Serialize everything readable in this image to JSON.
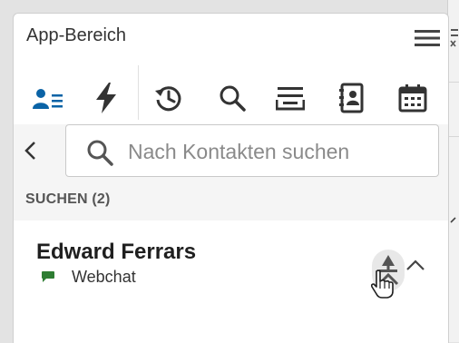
{
  "panel": {
    "title": "App-Bereich",
    "menu_icon": "hamburger-menu-icon"
  },
  "toolbar": {
    "active": "contacts",
    "items": [
      {
        "id": "contacts",
        "icon": "contacts-list-icon"
      },
      {
        "id": "actions",
        "icon": "lightning-icon"
      },
      {
        "id": "history",
        "icon": "history-icon"
      },
      {
        "id": "search",
        "icon": "search-icon"
      },
      {
        "id": "queue",
        "icon": "inbox-tray-icon"
      },
      {
        "id": "address-book",
        "icon": "address-book-icon"
      },
      {
        "id": "calendar",
        "icon": "calendar-icon"
      }
    ]
  },
  "search": {
    "placeholder": "Nach Kontakten suchen",
    "value": ""
  },
  "results": {
    "heading": "SUCHEN (2)"
  },
  "contact": {
    "name": "Edward Ferrars",
    "channel": "Webchat",
    "channel_color": "#2e7d32"
  },
  "colors": {
    "accent": "#0a63a6",
    "icon": "#1f1f1f"
  }
}
